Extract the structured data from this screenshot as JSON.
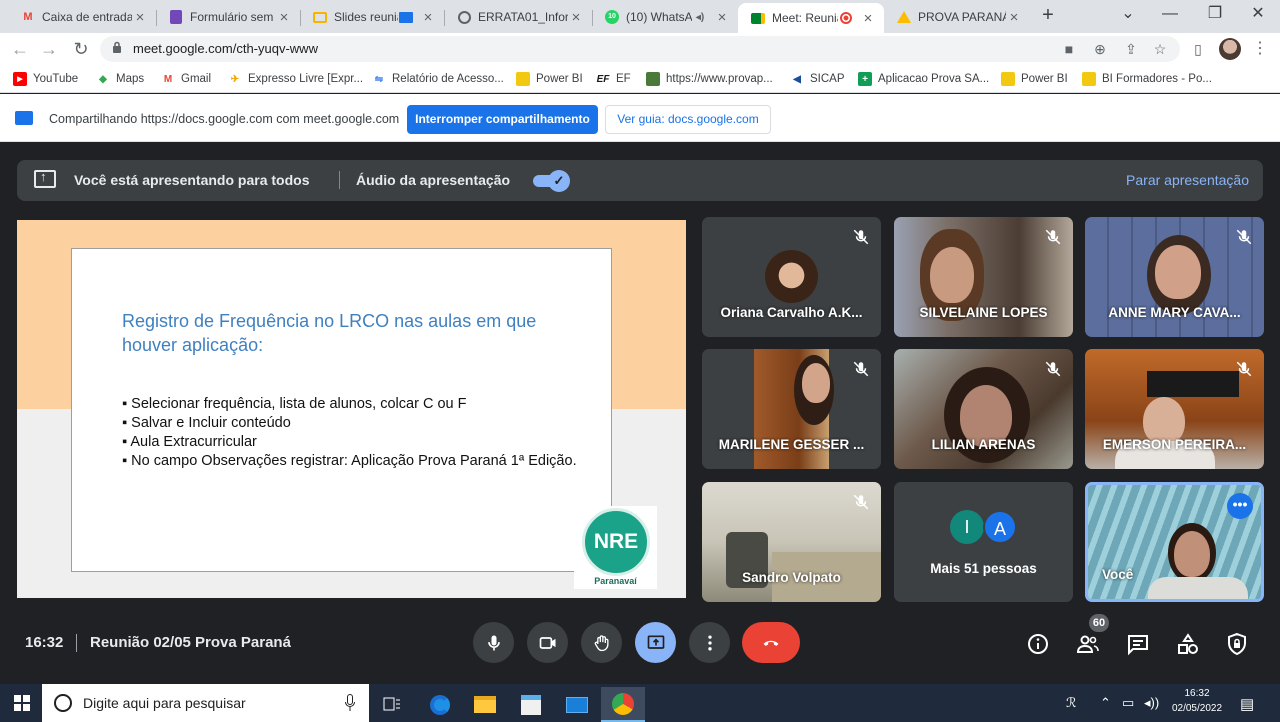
{
  "browser": {
    "tabs": [
      {
        "title": "Caixa de entrada",
        "icon": "gmail-icon"
      },
      {
        "title": "Formulário sem t",
        "icon": "forms-icon"
      },
      {
        "title": "Slides reuniã",
        "icon": "slides-icon"
      },
      {
        "title": "ERRATA01_Inform",
        "icon": "globe-icon"
      },
      {
        "title": "(10) WhatsA",
        "icon": "whatsapp-icon",
        "badge": "10"
      },
      {
        "title": "Meet: Reuniã",
        "icon": "meet-icon"
      },
      {
        "title": "PROVA PARANÁ",
        "icon": "drive-icon"
      }
    ],
    "url": "meet.google.com/cth-yuqv-www",
    "bookmarks": [
      {
        "label": "YouTube",
        "icon": "youtube-icon",
        "color": "#ff0000"
      },
      {
        "label": "Maps",
        "icon": "maps-icon",
        "color": "#34a853"
      },
      {
        "label": "Gmail",
        "icon": "gmail-icon",
        "color": "#ea4335"
      },
      {
        "label": "Expresso Livre [Expr...",
        "icon": "expresso-icon",
        "color": "#f4a300"
      },
      {
        "label": "Relatório de Acesso...",
        "icon": "report-icon",
        "color": "#4285f4"
      },
      {
        "label": "Power BI",
        "icon": "powerbi-icon",
        "color": "#f2c811"
      },
      {
        "label": "EF",
        "icon": "ef-icon",
        "color": "#1a1a1a"
      },
      {
        "label": "https://www.provap...",
        "icon": "link-icon",
        "color": "#4a7a3a"
      },
      {
        "label": "SICAP",
        "icon": "sicap-icon",
        "color": "#1a4fa0"
      },
      {
        "label": "Aplicacao Prova SA...",
        "icon": "sheets-icon",
        "color": "#0f9d58"
      },
      {
        "label": "Power BI",
        "icon": "powerbi-icon",
        "color": "#f2c811"
      },
      {
        "label": "BI Formadores - Po...",
        "icon": "powerbi-icon",
        "color": "#f2c811"
      }
    ]
  },
  "sharebar": {
    "text": "Compartilhando https://docs.google.com com meet.google.com",
    "stop_label": "Interromper compartilhamento",
    "guide_label": "Ver guia: docs.google.com"
  },
  "presenting": {
    "text": "Você está apresentando para todos",
    "audio_label": "Áudio da apresentação",
    "audio_enabled": true,
    "stop_label": "Parar apresentação"
  },
  "slide": {
    "title": "Registro de Frequência no LRCO nas aulas em que houver aplicação:",
    "bullets": [
      "Selecionar frequência, lista de alunos, colcar C ou F",
      "Salvar e Incluir conteúdo",
      "Aula Extracurricular",
      "No campo Observações registrar: Aplicação Prova Paraná 1ª Edição."
    ],
    "logo_text": "NRE",
    "logo_subtext": "Paranavaí",
    "colors": {
      "band_top": "#fdd19f",
      "band_bottom": "#efefef",
      "title": "#3f80c1",
      "logo": "#1aa389"
    }
  },
  "participants": [
    {
      "name": "Oriana Carvalho A.K...",
      "muted": true
    },
    {
      "name": "SILVELAINE LOPES",
      "muted": true
    },
    {
      "name": "ANNE MARY CAVA...",
      "muted": true
    },
    {
      "name": "MARILENE GESSER ...",
      "muted": true
    },
    {
      "name": "LILIAN ARENAS",
      "muted": true
    },
    {
      "name": "EMERSON PEREIRA...",
      "muted": true
    },
    {
      "name": "Sandro Volpato",
      "muted": true
    },
    {
      "name": "Mais 51 pessoas",
      "avatars": [
        "I",
        "A"
      ]
    },
    {
      "name": "Você",
      "muted": false
    }
  ],
  "meeting": {
    "time": "16:32",
    "title": "Reunião 02/05 Prova Paraná",
    "participant_count": "60"
  },
  "taskbar": {
    "search_placeholder": "Digite aqui para pesquisar",
    "clock_time": "16:32",
    "clock_date": "02/05/2022"
  }
}
